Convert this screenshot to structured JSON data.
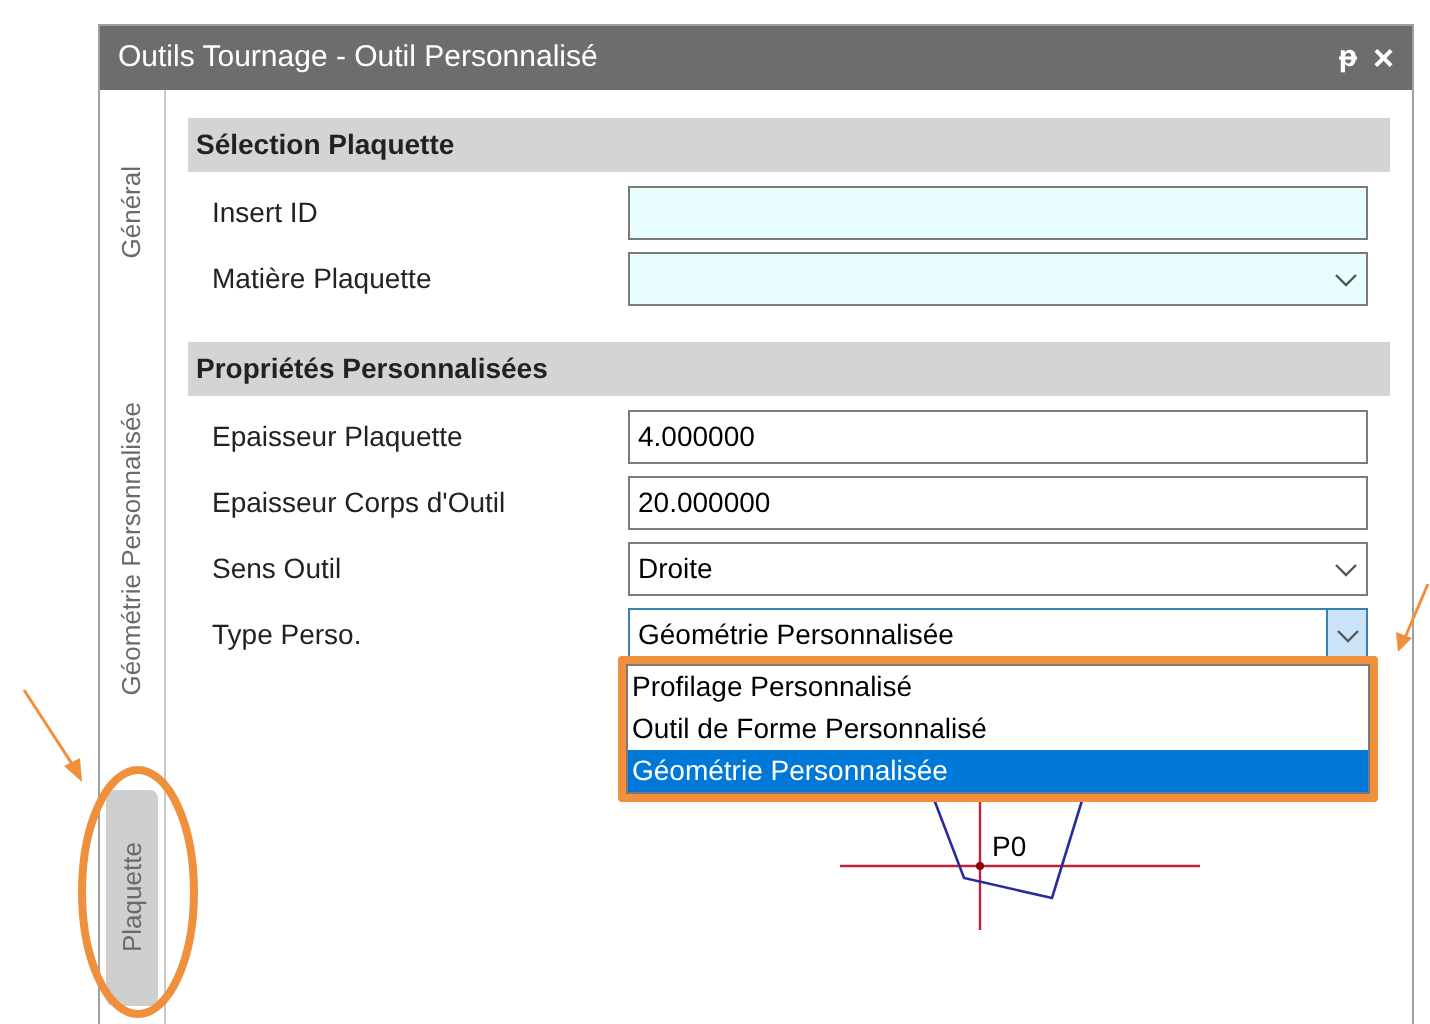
{
  "window": {
    "title": "Outils Tournage - Outil Personnalisé",
    "pin_glyph": "ᵽ",
    "close_glyph": "×"
  },
  "side_tabs": [
    {
      "label": "Général",
      "selected": false
    },
    {
      "label": "Géométrie Personnalisée",
      "selected": false
    },
    {
      "label": "Plaquette",
      "selected": true
    }
  ],
  "sections": [
    {
      "title": "Sélection Plaquette",
      "fields": [
        {
          "label": "Insert ID",
          "kind": "text",
          "highlighted": true
        },
        {
          "label": "Matière Plaquette",
          "kind": "dropdown",
          "highlighted": true,
          "expanded": false
        }
      ]
    },
    {
      "title": "Propriétés Personnalisées",
      "fields": [
        {
          "label": "Epaisseur Plaquette",
          "kind": "text",
          "highlighted": false,
          "value": "4.000000"
        },
        {
          "label": "Epaisseur Corps d'Outil",
          "kind": "text",
          "highlighted": false,
          "value": "20.000000"
        },
        {
          "label": "Sens Outil",
          "kind": "dropdown",
          "highlighted": false,
          "expanded": false,
          "value": "Droite"
        },
        {
          "label": "Type Perso.",
          "kind": "dropdown",
          "highlighted": false,
          "expanded": true,
          "value": "Géométrie Personnalisée",
          "options": [
            {
              "label": "Profilage Personnalisé",
              "selected": false
            },
            {
              "label": "Outil de Forme Personnalisé",
              "selected": false
            },
            {
              "label": "Géométrie Personnalisée",
              "selected": true
            }
          ]
        }
      ]
    }
  ],
  "preview": {
    "point_label": "P0"
  }
}
